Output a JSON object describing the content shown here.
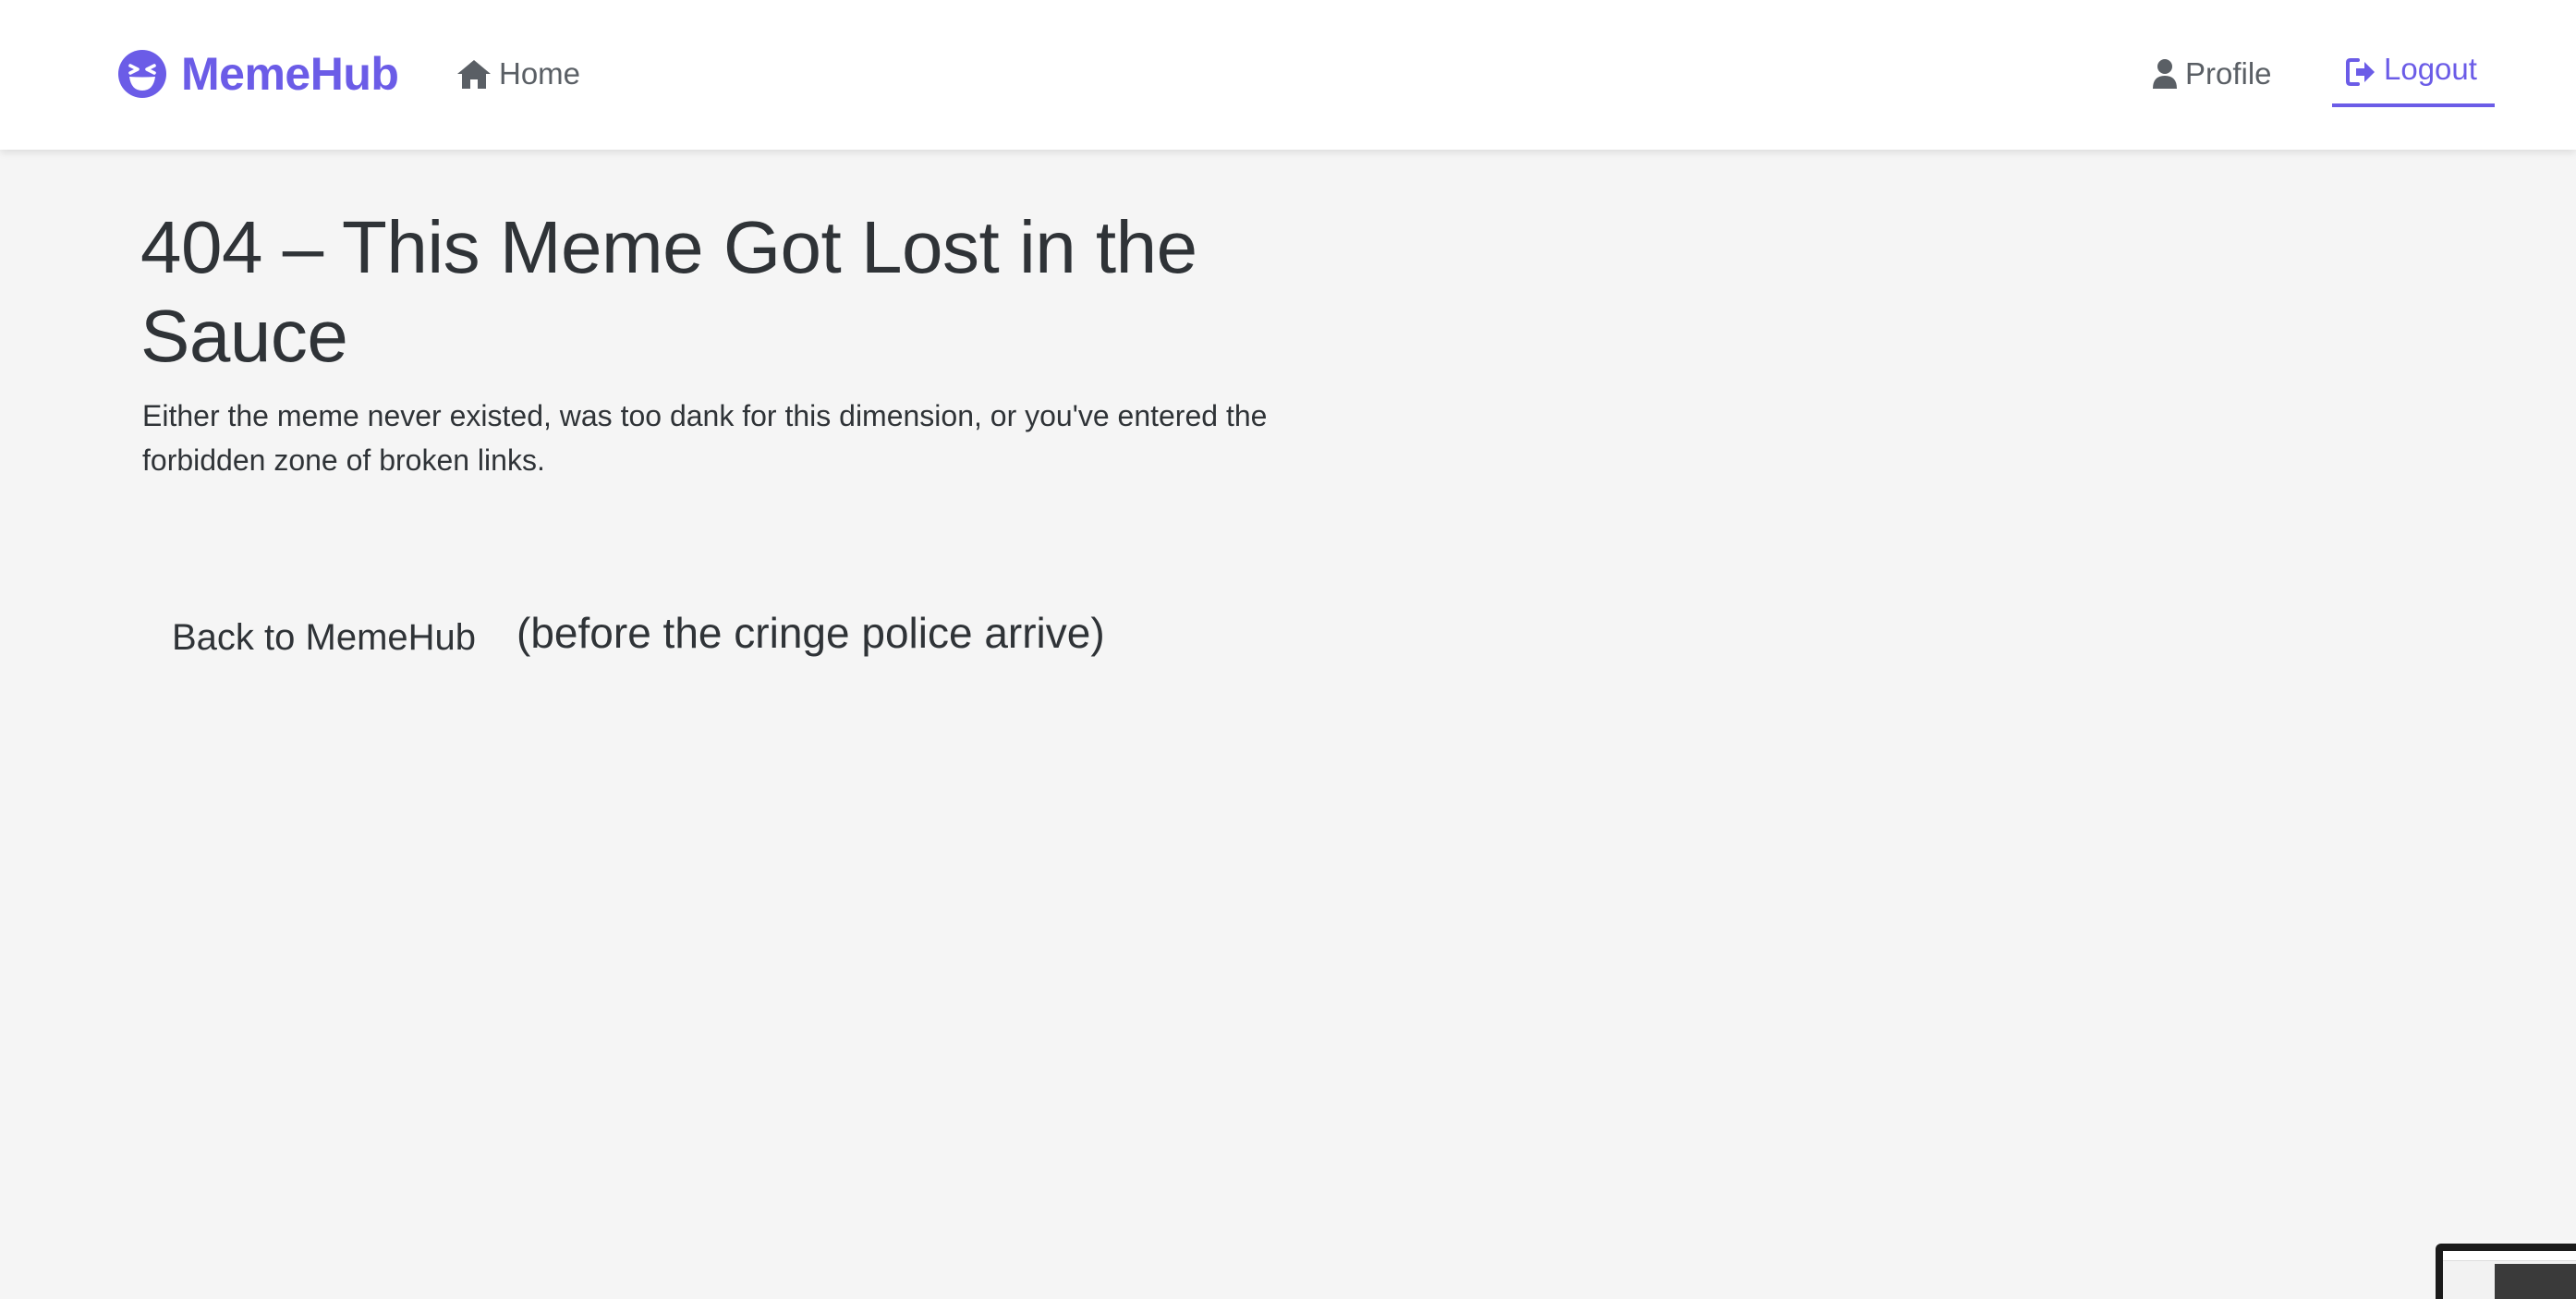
{
  "navbar": {
    "brand": "MemeHub",
    "brand_icon": "laughing-face-icon",
    "home": "Home",
    "home_icon": "home-icon",
    "profile": "Profile",
    "profile_icon": "user-icon",
    "logout": "Logout",
    "logout_icon": "sign-out-icon"
  },
  "main": {
    "title": "404 – This Meme Got Lost in the Sauce",
    "message": "Either the meme never existed, was too dank for this dimension, or you've entered the forbidden zone of broken links.",
    "back_button": "Back to MemeHub",
    "back_suffix": "(before the cringe police arrive)"
  },
  "colors": {
    "accent": "#6b5ce7",
    "text": "#2f3337",
    "muted": "#5a5f65",
    "background": "#f5f5f5",
    "navbar_bg": "#ffffff"
  }
}
